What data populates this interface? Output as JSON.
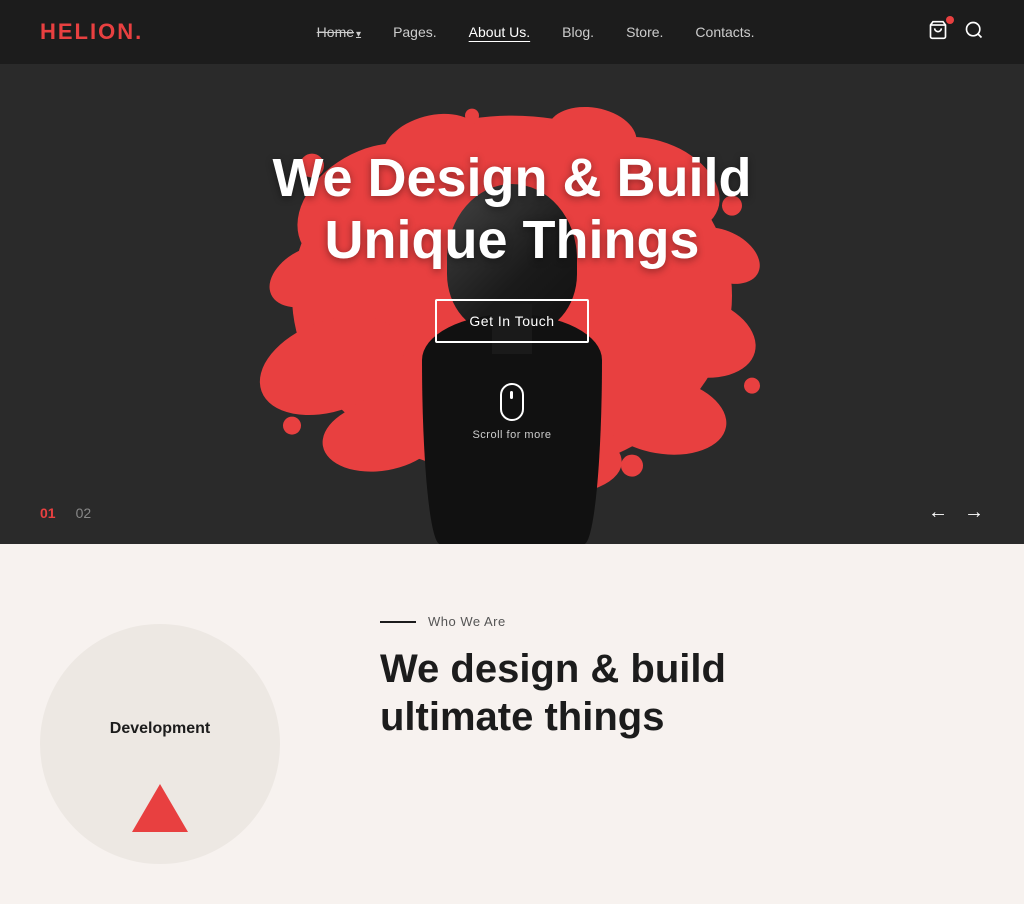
{
  "logo": {
    "text": "HELION",
    "dot": "."
  },
  "nav": {
    "items": [
      {
        "label": "Home.",
        "has_arrow": true,
        "active": false
      },
      {
        "label": "Pages.",
        "has_arrow": false,
        "active": false
      },
      {
        "label": "About Us.",
        "has_arrow": false,
        "active": true
      },
      {
        "label": "Blog.",
        "has_arrow": false,
        "active": false
      },
      {
        "label": "Store.",
        "has_arrow": false,
        "active": false
      },
      {
        "label": "Contacts.",
        "has_arrow": false,
        "active": false
      }
    ]
  },
  "hero": {
    "title_line1": "We Design & Build",
    "title_line2": "Unique Things",
    "cta_label": "Get In Touch",
    "scroll_label": "Scroll for more",
    "slide_active": "01",
    "slide_inactive": "02",
    "colors": {
      "bg": "#2a2a2a",
      "accent": "#e84040"
    }
  },
  "below": {
    "dev_label": "Development",
    "eyebrow_line": "—",
    "eyebrow_text": "Who We Are",
    "section_title_line1": "We design & build",
    "section_title_line2": "ultimate things"
  }
}
